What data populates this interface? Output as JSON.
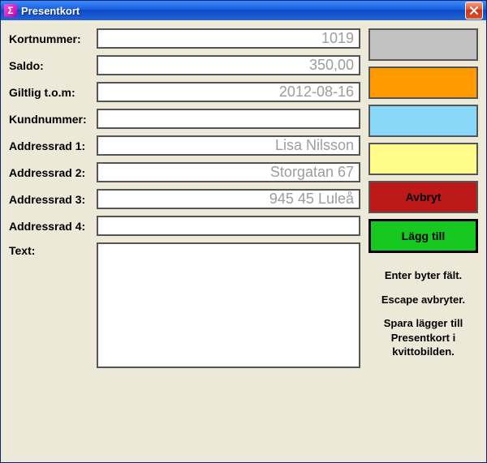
{
  "window": {
    "title": "Presentkort"
  },
  "labels": {
    "kortnummer": "Kortnummer:",
    "saldo": "Saldo:",
    "giltlig": "Giltlig t.o.m:",
    "kundnummer": "Kundnummer:",
    "addr1": "Addressrad 1:",
    "addr2": "Addressrad 2:",
    "addr3": "Addressrad 3:",
    "addr4": "Addressrad 4:",
    "text": "Text:"
  },
  "values": {
    "kortnummer": "1019",
    "saldo": "350,00",
    "giltlig": "2012-08-16",
    "kundnummer": "",
    "addr1": "Lisa Nilsson",
    "addr2": "Storgatan 67",
    "addr3": "945 45 Luleå",
    "addr4": "",
    "text": ""
  },
  "buttons": {
    "avbryt": "Avbryt",
    "laggtill": "Lägg till"
  },
  "hints": {
    "l1": "Enter byter fält.",
    "l2": "Escape avbryter.",
    "l3": "Spara lägger till Presentkort i kvittobilden."
  }
}
